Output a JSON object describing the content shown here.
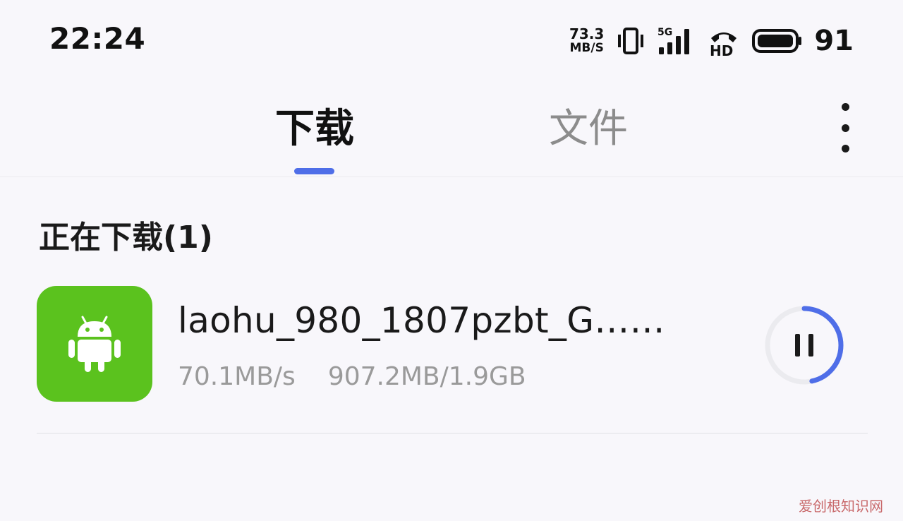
{
  "status_bar": {
    "time": "22:24",
    "net_speed_value": "73.3",
    "net_speed_unit": "MB/S",
    "signal_label": "5G",
    "hd_label": "HD",
    "battery_level": "91",
    "icons": [
      "vibrate-icon",
      "signal-icon",
      "volte-icon",
      "battery-icon"
    ]
  },
  "tabs": [
    {
      "label": "下载",
      "active": true
    },
    {
      "label": "文件",
      "active": false
    }
  ],
  "more_menu": {
    "icon": "more-vertical-icon"
  },
  "section": {
    "title": "正在下载(1)"
  },
  "downloads": [
    {
      "icon": "android-icon",
      "name": "laohu_980_1807pzbt_G……",
      "speed": "70.1MB/s",
      "progress_text": "907.2MB/1.9GB",
      "progress": 0.466,
      "action_icon": "pause-icon"
    }
  ],
  "watermark": "爱创根知识网",
  "colors": {
    "accent": "#4f6ee8",
    "app_icon_bg": "#5bc21e",
    "background": "#f8f7fb",
    "muted_text": "#9a9a9a"
  }
}
